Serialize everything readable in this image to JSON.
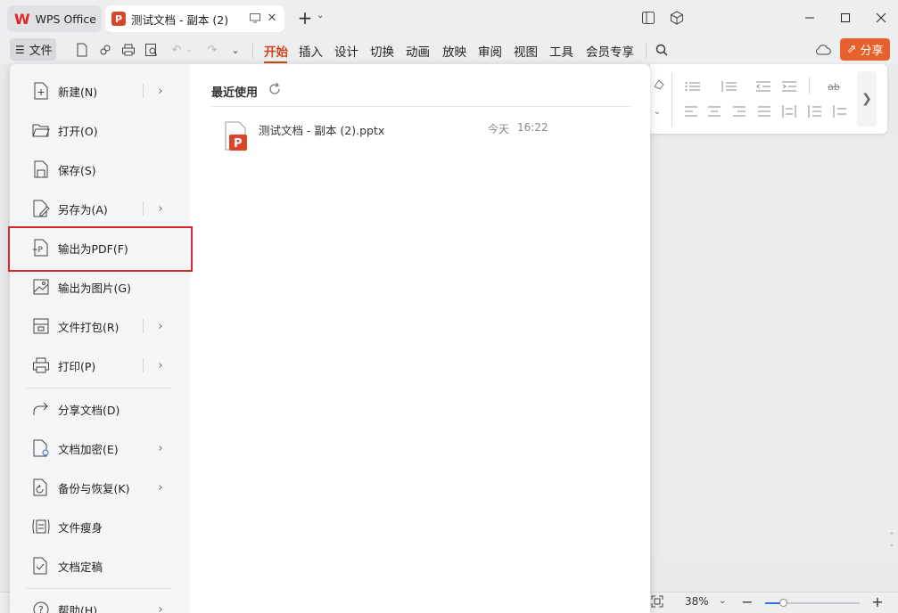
{
  "titlebar": {
    "home_tab_label": "WPS Office",
    "doc_tab_label": "测试文档 - 副本 (2)",
    "doc_badge": "P"
  },
  "menurow": {
    "file_label": "文件",
    "ribbon_tabs": [
      "开始",
      "插入",
      "设计",
      "切换",
      "动画",
      "放映",
      "审阅",
      "视图",
      "工具",
      "会员专享"
    ],
    "active_tab": "开始",
    "share_label": "分享"
  },
  "filemenu": {
    "items": [
      {
        "label": "新建(N)",
        "icon": "new-file-icon",
        "submenu": true
      },
      {
        "label": "打开(O)",
        "icon": "open-folder-icon",
        "submenu": false
      },
      {
        "label": "保存(S)",
        "icon": "save-icon",
        "submenu": false
      },
      {
        "label": "另存为(A)",
        "icon": "save-as-icon",
        "submenu": true
      },
      {
        "label": "输出为PDF(F)",
        "icon": "export-pdf-icon",
        "submenu": false,
        "highlighted": true
      },
      {
        "label": "输出为图片(G)",
        "icon": "export-image-icon",
        "submenu": false
      },
      {
        "label": "文件打包(R)",
        "icon": "package-icon",
        "submenu": true
      },
      {
        "label": "打印(P)",
        "icon": "print-icon",
        "submenu": true
      },
      {
        "label": "分享文档(D)",
        "icon": "share-doc-icon",
        "submenu": false
      },
      {
        "label": "文档加密(E)",
        "icon": "encrypt-icon",
        "submenu": true
      },
      {
        "label": "备份与恢复(K)",
        "icon": "backup-icon",
        "submenu": true
      },
      {
        "label": "文件瘦身",
        "icon": "slim-icon",
        "submenu": false
      },
      {
        "label": "文档定稿",
        "icon": "finalize-icon",
        "submenu": false
      },
      {
        "label": "帮助(H)",
        "icon": "help-icon",
        "submenu": true
      }
    ],
    "recent_title": "最近使用",
    "recent_files": [
      {
        "name": "测试文档 - 副本 (2).pptx",
        "date": "今天",
        "time": "16:22",
        "badge": "P"
      }
    ]
  },
  "status": {
    "zoom": "38%"
  },
  "colors": {
    "accent": "#d0461b",
    "share_button": "#e8612c",
    "highlight_border": "#d9262d",
    "ppt_icon": "#d9442b"
  }
}
